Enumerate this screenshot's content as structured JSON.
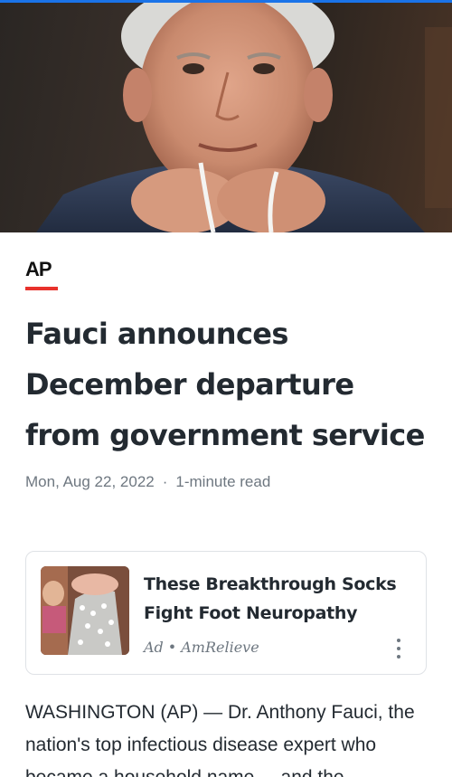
{
  "article": {
    "publisher": "AP",
    "headline": "Fauci announces December departure from government service",
    "date": "Mon, Aug 22, 2022",
    "separator": "·",
    "read_time": "1-minute read",
    "body": "WASHINGTON (AP) — Dr. Anthony Fauci, the nation's top infectious disease expert who became a household name ... and the"
  },
  "ad": {
    "title": "These Breakthrough Socks Fight Foot Neuropathy",
    "label": "Ad",
    "separator": "•",
    "sponsor": "AmRelieve",
    "menu_icon": "more-vertical-icon"
  },
  "colors": {
    "accent_top": "#1a73e8",
    "ap_underline": "#e8322c",
    "text_primary": "#232a31",
    "text_secondary": "#6e7780"
  }
}
